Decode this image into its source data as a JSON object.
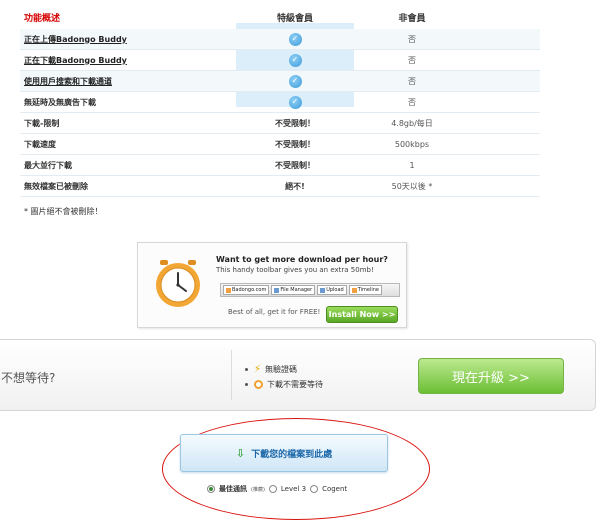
{
  "table": {
    "headers": {
      "feature": "功能概述",
      "premium": "特級會員",
      "free": "非會員"
    },
    "rows": [
      {
        "feature": "正在上傳Badongo Buddy",
        "premium": "check",
        "free": "否",
        "link": true
      },
      {
        "feature": "正在下載Badongo Buddy",
        "premium": "check",
        "free": "否",
        "link": true
      },
      {
        "feature": "使用用戶搜索和下載通道",
        "premium": "check",
        "free": "否",
        "link": true
      },
      {
        "feature": "無延時及無廣告下載",
        "premium": "check",
        "free": "否",
        "link": false
      },
      {
        "feature": "下載-限制",
        "premium": "不受限制！",
        "free": "4.8gb/每日",
        "link": false
      },
      {
        "feature": "下載速度",
        "premium": "不受限制！",
        "free": "500kbps",
        "link": false
      },
      {
        "feature": "最大並行下載",
        "premium": "不受限制！",
        "free": "1",
        "link": false
      },
      {
        "feature": "無效檔案已被刪除",
        "premium": "絕不!",
        "free": "50天以後 *",
        "link": false
      }
    ],
    "note": "* 圖片絕不會被刪除！"
  },
  "promo": {
    "title": "Want to get more download per hour?",
    "desc": "This handy toolbar gives you an extra 50mb!",
    "toolbar": [
      "Badongo.com",
      "File Manager",
      "Upload",
      "Timeline"
    ],
    "best": "Best of all, get it for FREE!",
    "install": "Install Now >>",
    "icon": "alarm-clock-icon"
  },
  "banner": {
    "question": "不想等待?",
    "features": [
      "無驗證碼",
      "下載不需要等待"
    ],
    "upgrade": "現在升級 >>"
  },
  "download": {
    "label": "下載您的檔案到此處",
    "mirrors": {
      "best": "最佳通訊",
      "best_sub": "(推薦)",
      "level3": "Level 3",
      "cogent": "Cogent",
      "selected": "best"
    }
  },
  "colors": {
    "header_red": "#d40000",
    "highlight_col": "#dbeefa",
    "upgrade_green": "#6cbf35",
    "ellipse_red": "#d9140f"
  }
}
